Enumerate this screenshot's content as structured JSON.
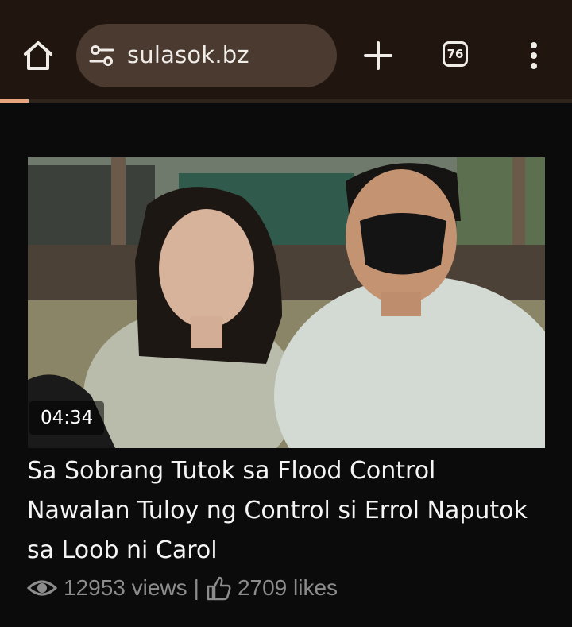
{
  "browser": {
    "url": "sulasok.bz",
    "tab_count": "76",
    "load_progress": 0.05,
    "icons": [
      "home-icon",
      "tune-icon",
      "plus-icon",
      "tab-switcher-icon",
      "more-vert-icon"
    ]
  },
  "video": {
    "duration": "04:34",
    "title_lines": [
      "Sa Sobrang Tutok sa Flood Control",
      "Nawalan Tuloy ng Control si Errol Naputok",
      "sa Loob ni Carol"
    ],
    "views": "12953 views",
    "separator": "|",
    "likes": "2709 likes",
    "icons": [
      "eye-icon",
      "thumbs-up-icon"
    ]
  },
  "colors": {
    "toolbar_bg": "#21160f",
    "urlbar_bg": "#4a3a30",
    "progress": "#e7a57f",
    "page_bg": "#0b0b0b",
    "meta_text": "#8c8c8c"
  }
}
